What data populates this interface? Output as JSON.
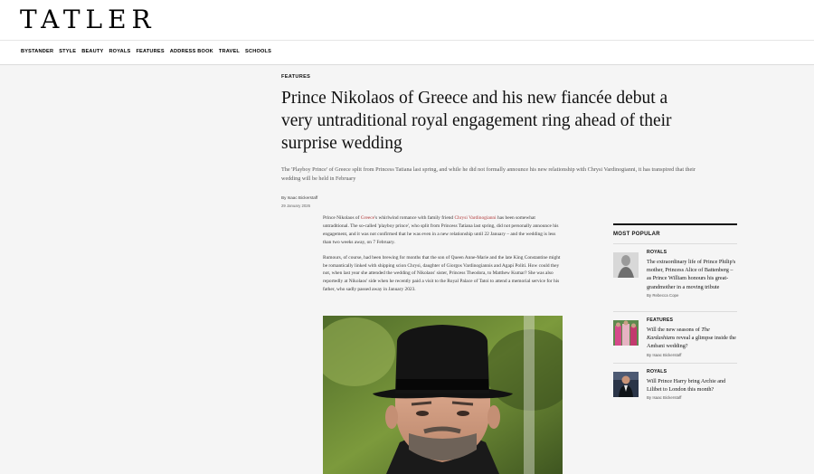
{
  "brand": {
    "logo": "TATLER"
  },
  "nav": {
    "items": [
      "BYSTANDER",
      "STYLE",
      "BEAUTY",
      "ROYALS",
      "FEATURES",
      "ADDRESS BOOK",
      "TRAVEL",
      "SCHOOLS"
    ]
  },
  "article": {
    "category": "FEATURES",
    "headline": "Prince Nikolaos of Greece and his new fiancée debut a very untraditional royal engagement ring ahead of their surprise wedding",
    "standfirst": "The 'Playboy Prince' of Greece split from Princess Tatiana last spring, and while he did not formally announce his new relationship with Chrysi Vardinogianni, it has transpired that their wedding will be held in February",
    "byline": "By Isaac Bickerstaff",
    "date": "29 January 2026",
    "p1_a": "Prince Nikolaos of ",
    "p1_link1": "Greece",
    "p1_b": "'s whirlwind romance with family friend ",
    "p1_link2": "Chrysi Vardinogianni",
    "p1_c": " has been somewhat untraditional. The so-called 'playboy prince', who split from Princess Tatiana last spring, did not personally announce his engagement, and it was not confirmed that he was even in a new relationship until 22 January – and the wedding is less than two weeks away, on 7 February.",
    "p2": "Rumours, of course, had been brewing for months that the son of Queen Anne-Marie and the late King Constantine might be romantically linked with shipping scion Chrysi, daughter of Giorgos Vardinogiannis and Agapi Politi. How could they not, when last year she attended the wedding of Nikolaos' sister, Princess Theodora, to Matthew Kumar? She was also reportedly at Nikolaos' side when he recently paid a visit to the Royal Palace of Tatoi to attend a memorial service for his father, who sadly passed away in January 2023."
  },
  "sidebar": {
    "heading": "MOST POPULAR",
    "items": [
      {
        "category": "ROYALS",
        "title": "The extraordinary life of Prince Philip's mother, Princess Alice of Battenberg – as Prince William honours his great-grandmother in a moving tribute",
        "author": "By Rebecca Cope"
      },
      {
        "category": "FEATURES",
        "title_a": "Will the new seasons of ",
        "title_em": "The Kardashians",
        "title_b": " reveal a glimpse inside the Ambani wedding?",
        "author": "By Isaac Bickerstaff"
      },
      {
        "category": "ROYALS",
        "title": "Will Prince Harry bring Archie and Lilibet to London this month?",
        "author": "By Isaac Bickerstaff"
      }
    ]
  },
  "colors": {
    "link": "#b03a3a",
    "background": "#f5f5f5",
    "header": "#ffffff"
  }
}
